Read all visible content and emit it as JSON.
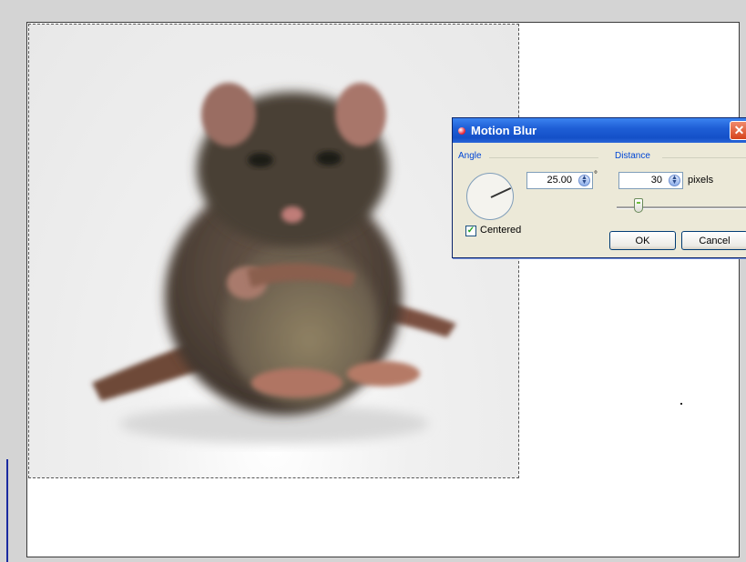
{
  "dialog": {
    "title": "Motion Blur",
    "angle_label": "Angle",
    "angle_value": "25.00",
    "degree_symbol": "°",
    "distance_label": "Distance",
    "distance_value": "30",
    "distance_unit": "pixels",
    "centered_label": "Centered",
    "centered_checked": true,
    "ok_label": "OK",
    "cancel_label": "Cancel",
    "close_glyph": "✕"
  },
  "colors": {
    "titlebar": "#1f5fd6",
    "dialog_bg": "#ece9d8",
    "label_blue": "#0046d5"
  },
  "icons": {
    "spin_up_down": "spinner-icon",
    "title": "motion-blur-icon"
  }
}
